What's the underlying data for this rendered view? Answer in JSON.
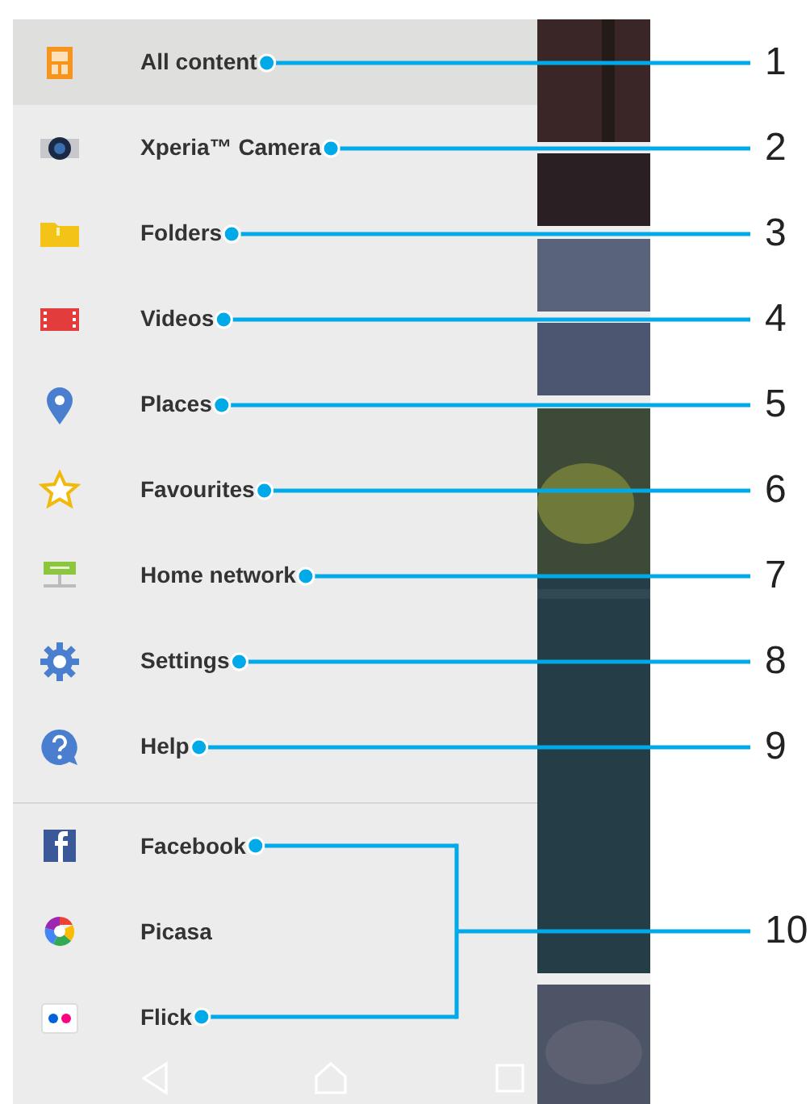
{
  "menu_sections": [
    {
      "items": [
        {
          "label": "All content",
          "selected": true
        },
        {
          "label": "Xperia™ Camera",
          "selected": false
        },
        {
          "label": "Folders",
          "selected": false
        },
        {
          "label": "Videos",
          "selected": false
        },
        {
          "label": "Places",
          "selected": false
        },
        {
          "label": "Favourites",
          "selected": false
        },
        {
          "label": "Home network",
          "selected": false
        },
        {
          "label": "Settings",
          "selected": false
        },
        {
          "label": "Help",
          "selected": false
        }
      ]
    },
    {
      "items": [
        {
          "label": "Facebook",
          "selected": false
        },
        {
          "label": "Picasa",
          "selected": false
        },
        {
          "label": "Flick",
          "selected": false
        }
      ]
    }
  ],
  "callouts": [
    {
      "number": "1"
    },
    {
      "number": "2"
    },
    {
      "number": "3"
    },
    {
      "number": "4"
    },
    {
      "number": "5"
    },
    {
      "number": "6"
    },
    {
      "number": "7"
    },
    {
      "number": "8"
    },
    {
      "number": "9"
    },
    {
      "number": "10"
    }
  ]
}
